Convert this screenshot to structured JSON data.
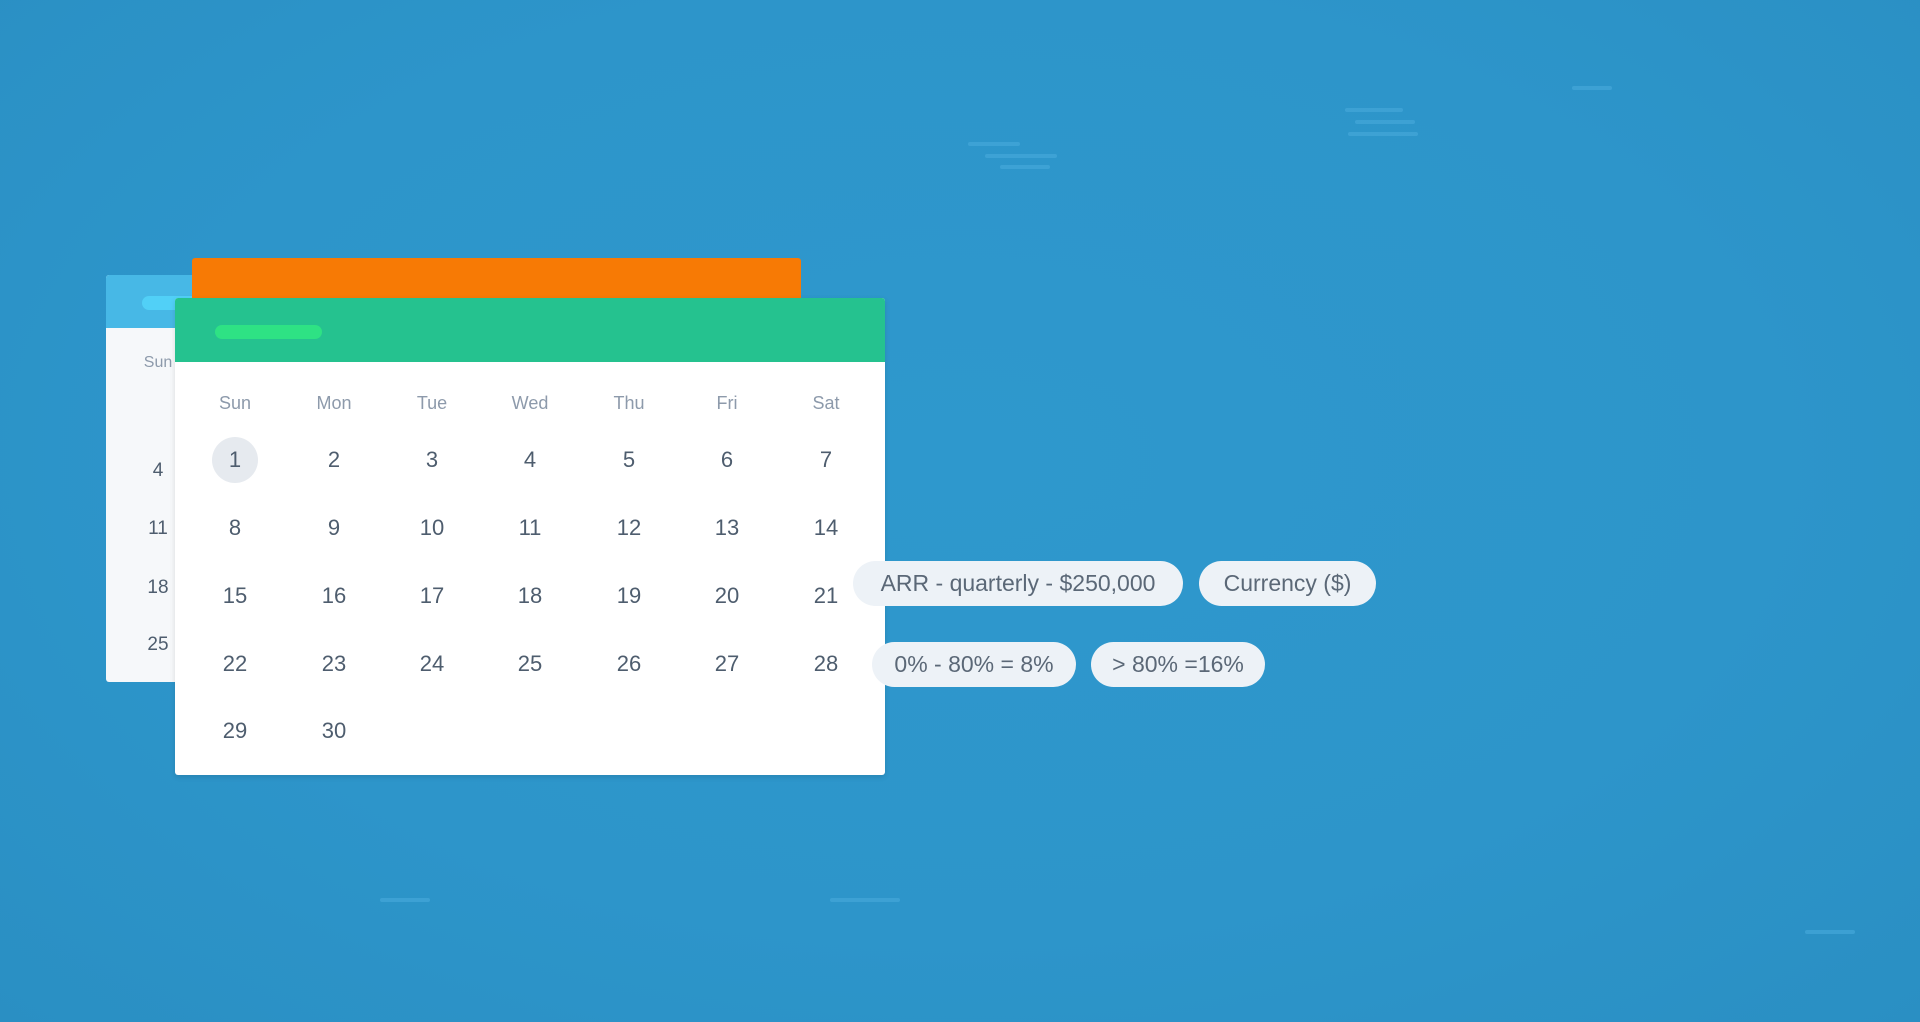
{
  "colors": {
    "background": "#2e97cc",
    "back_header": "#47b8e6",
    "middle_header": "#f77a05",
    "front_header": "#25c28f",
    "accent_pill": "#2ee284"
  },
  "back_calendar": {
    "weekday": "Sun",
    "days": [
      "4",
      "11",
      "18",
      "25"
    ]
  },
  "calendar": {
    "weekdays": [
      "Sun",
      "Mon",
      "Tue",
      "Wed",
      "Thu",
      "Fri",
      "Sat"
    ],
    "selected_day": "1",
    "weeks": [
      [
        "1",
        "2",
        "3",
        "4",
        "5",
        "6",
        "7"
      ],
      [
        "8",
        "9",
        "10",
        "11",
        "12",
        "13",
        "14"
      ],
      [
        "15",
        "16",
        "17",
        "18",
        "19",
        "20",
        "21"
      ],
      [
        "22",
        "23",
        "24",
        "25",
        "26",
        "27",
        "28"
      ],
      [
        "29",
        "30"
      ]
    ]
  },
  "tags": [
    "ARR - quarterly - $250,000",
    "Currency ($)",
    "0% - 80% = 8%",
    "> 80% =16%"
  ]
}
